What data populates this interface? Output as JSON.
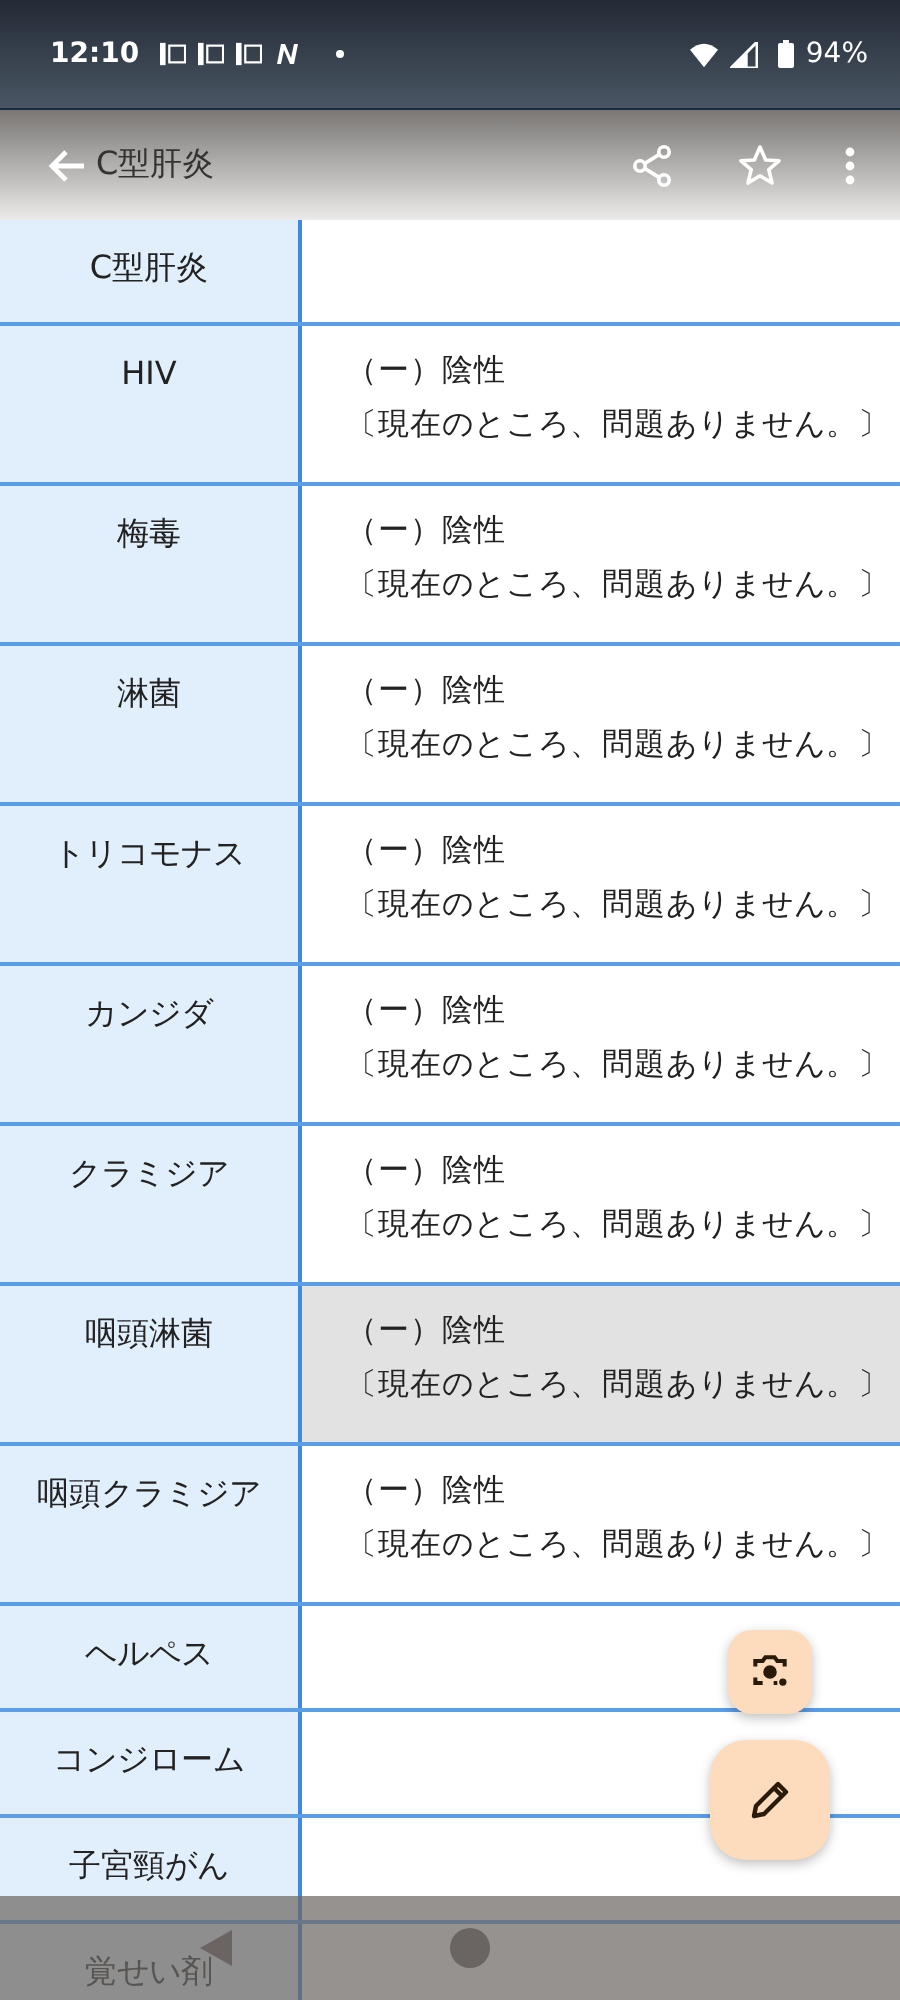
{
  "status_bar": {
    "time": "12:10",
    "battery": "94%"
  },
  "app_bar": {
    "title": "C型肝炎"
  },
  "rows": [
    {
      "item": "C型肝炎",
      "result": "",
      "note": "",
      "selected": false
    },
    {
      "item": "HIV",
      "result": "（ー）陰性",
      "note": "〔現在のところ、問題ありません。〕",
      "selected": false
    },
    {
      "item": "梅毒",
      "result": "（ー）陰性",
      "note": "〔現在のところ、問題ありません。〕",
      "selected": false
    },
    {
      "item": "淋菌",
      "result": "（ー）陰性",
      "note": "〔現在のところ、問題ありません。〕",
      "selected": false
    },
    {
      "item": "トリコモナス",
      "result": "（ー）陰性",
      "note": "〔現在のところ、問題ありません。〕",
      "selected": false
    },
    {
      "item": "カンジダ",
      "result": "（ー）陰性",
      "note": "〔現在のところ、問題ありません。〕",
      "selected": false
    },
    {
      "item": "クラミジア",
      "result": "（ー）陰性",
      "note": "〔現在のところ、問題ありません。〕",
      "selected": false
    },
    {
      "item": "咽頭淋菌",
      "result": "（ー）陰性",
      "note": "〔現在のところ、問題ありません。〕",
      "selected": true
    },
    {
      "item": "咽頭クラミジア",
      "result": "（ー）陰性",
      "note": "〔現在のところ、問題ありません。〕",
      "selected": false
    },
    {
      "item": "ヘルペス",
      "result": "",
      "note": "",
      "selected": false
    },
    {
      "item": "コンジローム",
      "result": "",
      "note": "",
      "selected": false
    },
    {
      "item": "子宮頸がん",
      "result": "",
      "note": "",
      "selected": false
    },
    {
      "item": "覚せい剤",
      "result": "",
      "note": ""
    }
  ]
}
